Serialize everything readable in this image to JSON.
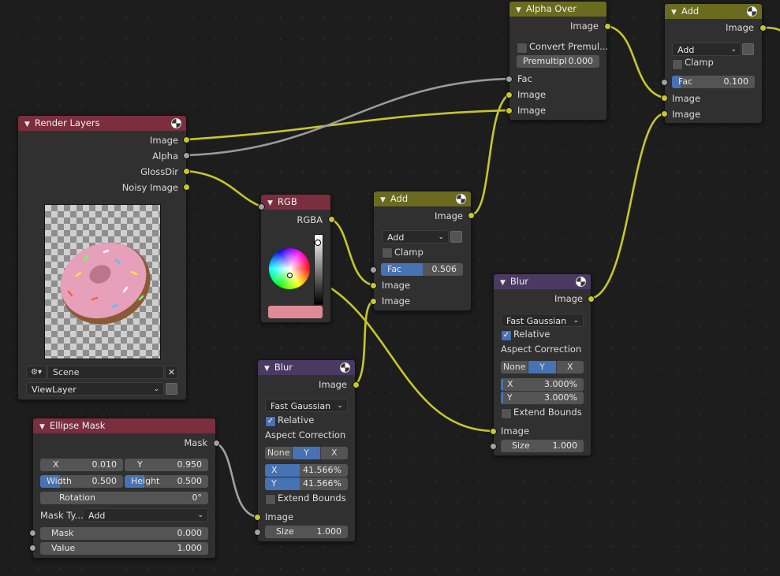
{
  "colors": {
    "image_socket": "#c7c729",
    "value_socket": "#a1a1a1",
    "header_input": "#7a2e3e",
    "header_color": "#6a6b1e",
    "header_filter": "#4a3a62",
    "active": "#4772b3"
  },
  "render_layers": {
    "title": "Render Layers",
    "outputs": [
      "Image",
      "Alpha",
      "GlossDir",
      "Noisy Image"
    ],
    "preview_icon": "donut-render-preview",
    "scene_label": "Scene",
    "view_layer": "ViewLayer"
  },
  "ellipse_mask": {
    "title": "Ellipse Mask",
    "output": "Mask",
    "x_label": "X",
    "x_value": "0.010",
    "y_label": "Y",
    "y_value": "0.950",
    "width_label": "Width",
    "width_value": "0.500",
    "height_label": "Height",
    "height_value": "0.500",
    "rotation_label": "Rotation",
    "rotation_value": "0°",
    "mask_type_label": "Mask Ty...",
    "mask_type_value": "Add",
    "mask_label": "Mask",
    "mask_value": "0.000",
    "value_label": "Value",
    "value_value": "1.000"
  },
  "rgb": {
    "title": "RGB",
    "output": "RGBA",
    "color": "#e08a97"
  },
  "add_mid": {
    "title": "Add",
    "output": "Image",
    "blend_mode": "Add",
    "clamp_label": "Clamp",
    "fac_label": "Fac",
    "fac_value": "0.506",
    "fac_fraction": 0.506,
    "input1": "Image",
    "input2": "Image"
  },
  "blur_low": {
    "title": "Blur",
    "output": "Image",
    "filter": "Fast Gaussian",
    "relative_label": "Relative",
    "aspect_label": "Aspect Correction",
    "aspect_options": [
      "None",
      "Y",
      "X"
    ],
    "aspect_selected": "Y",
    "x_label": "X",
    "x_value": "41.566%",
    "y_label": "Y",
    "y_value": "41.566%",
    "extend_label": "Extend Bounds",
    "input": "Image",
    "size_label": "Size",
    "size_value": "1.000"
  },
  "blur_right": {
    "title": "Blur",
    "output": "Image",
    "filter": "Fast Gaussian",
    "relative_label": "Relative",
    "aspect_label": "Aspect Correction",
    "aspect_options": [
      "None",
      "Y",
      "X"
    ],
    "aspect_selected": "Y",
    "x_label": "X",
    "x_value": "3.000%",
    "y_label": "Y",
    "y_value": "3.000%",
    "extend_label": "Extend Bounds",
    "input": "Image",
    "size_label": "Size",
    "size_value": "1.000"
  },
  "alpha_over": {
    "title": "Alpha Over",
    "output": "Image",
    "convert_label": "Convert Premul...",
    "premul_label": "Premultipl",
    "premul_value": "0.000",
    "fac_label": "Fac",
    "input1": "Image",
    "input2": "Image"
  },
  "add_right": {
    "title": "Add",
    "output": "Image",
    "blend_mode": "Add",
    "clamp_label": "Clamp",
    "fac_label": "Fac",
    "fac_value": "0.100",
    "fac_fraction": 0.1,
    "input1": "Image",
    "input2": "Image"
  }
}
